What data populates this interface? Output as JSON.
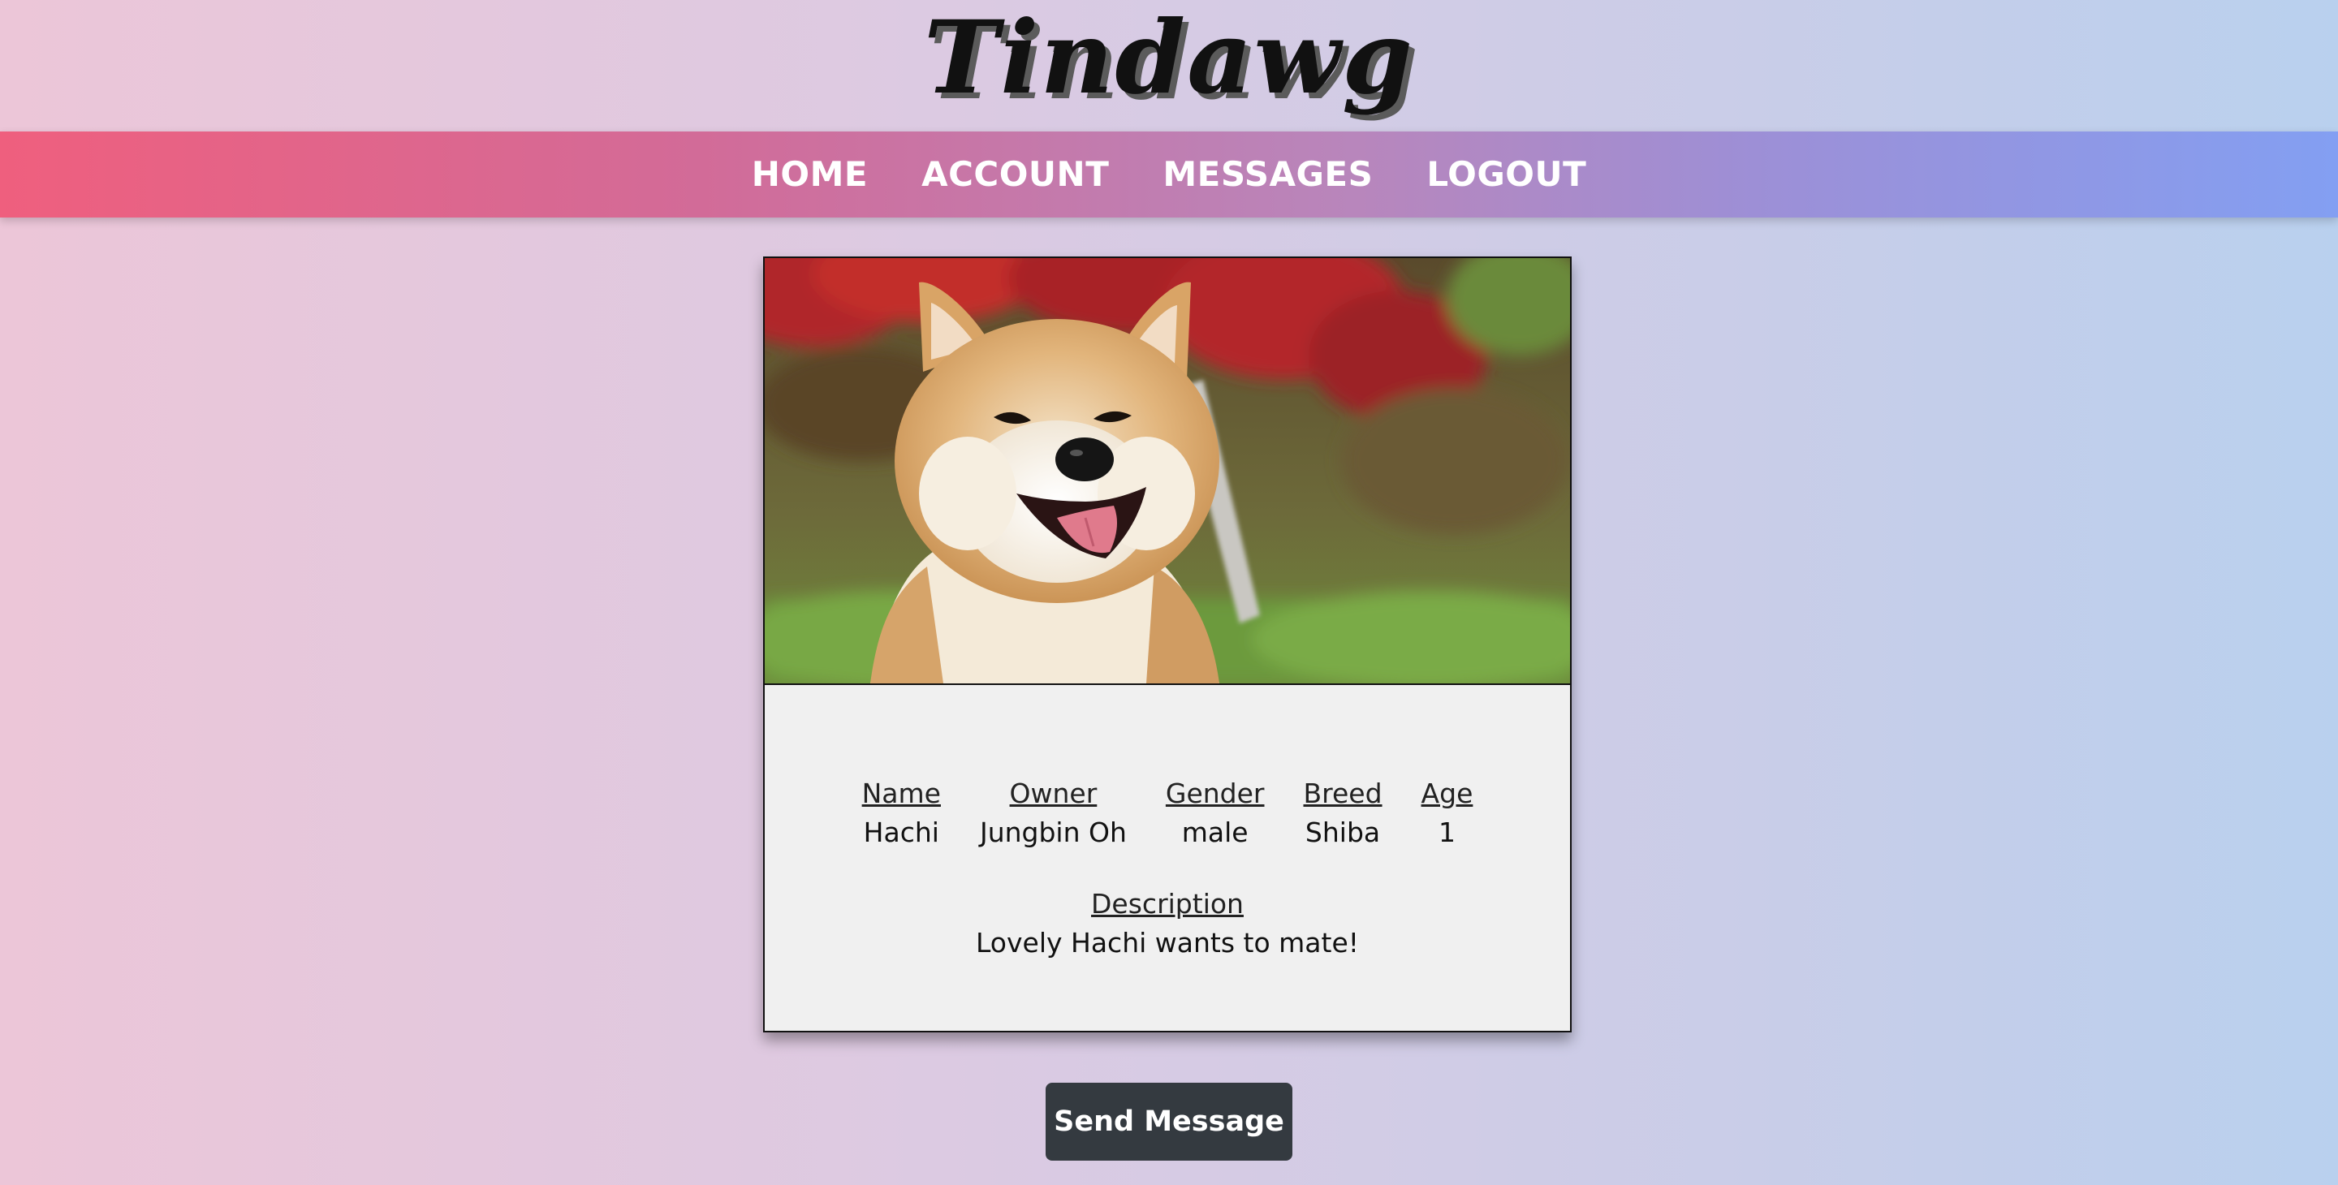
{
  "app": {
    "logo_text": "Tindawg"
  },
  "nav": {
    "items": [
      {
        "label": "HOME"
      },
      {
        "label": "ACCOUNT"
      },
      {
        "label": "MESSAGES"
      },
      {
        "label": "LOGOUT"
      }
    ]
  },
  "profile": {
    "photo_icon": "shiba-dog-photo",
    "fields": [
      {
        "header": "Name",
        "value": "Hachi"
      },
      {
        "header": "Owner",
        "value": "Jungbin Oh"
      },
      {
        "header": "Gender",
        "value": "male"
      },
      {
        "header": "Breed",
        "value": "Shiba"
      },
      {
        "header": "Age",
        "value": "1"
      }
    ],
    "description": {
      "header": "Description",
      "value": "Lovely Hachi wants to mate!"
    }
  },
  "actions": {
    "send_label": "Send Message"
  },
  "colors": {
    "navbar_start": "#ef5f7e",
    "navbar_end": "#839ff2",
    "button_bg": "#343a40"
  }
}
